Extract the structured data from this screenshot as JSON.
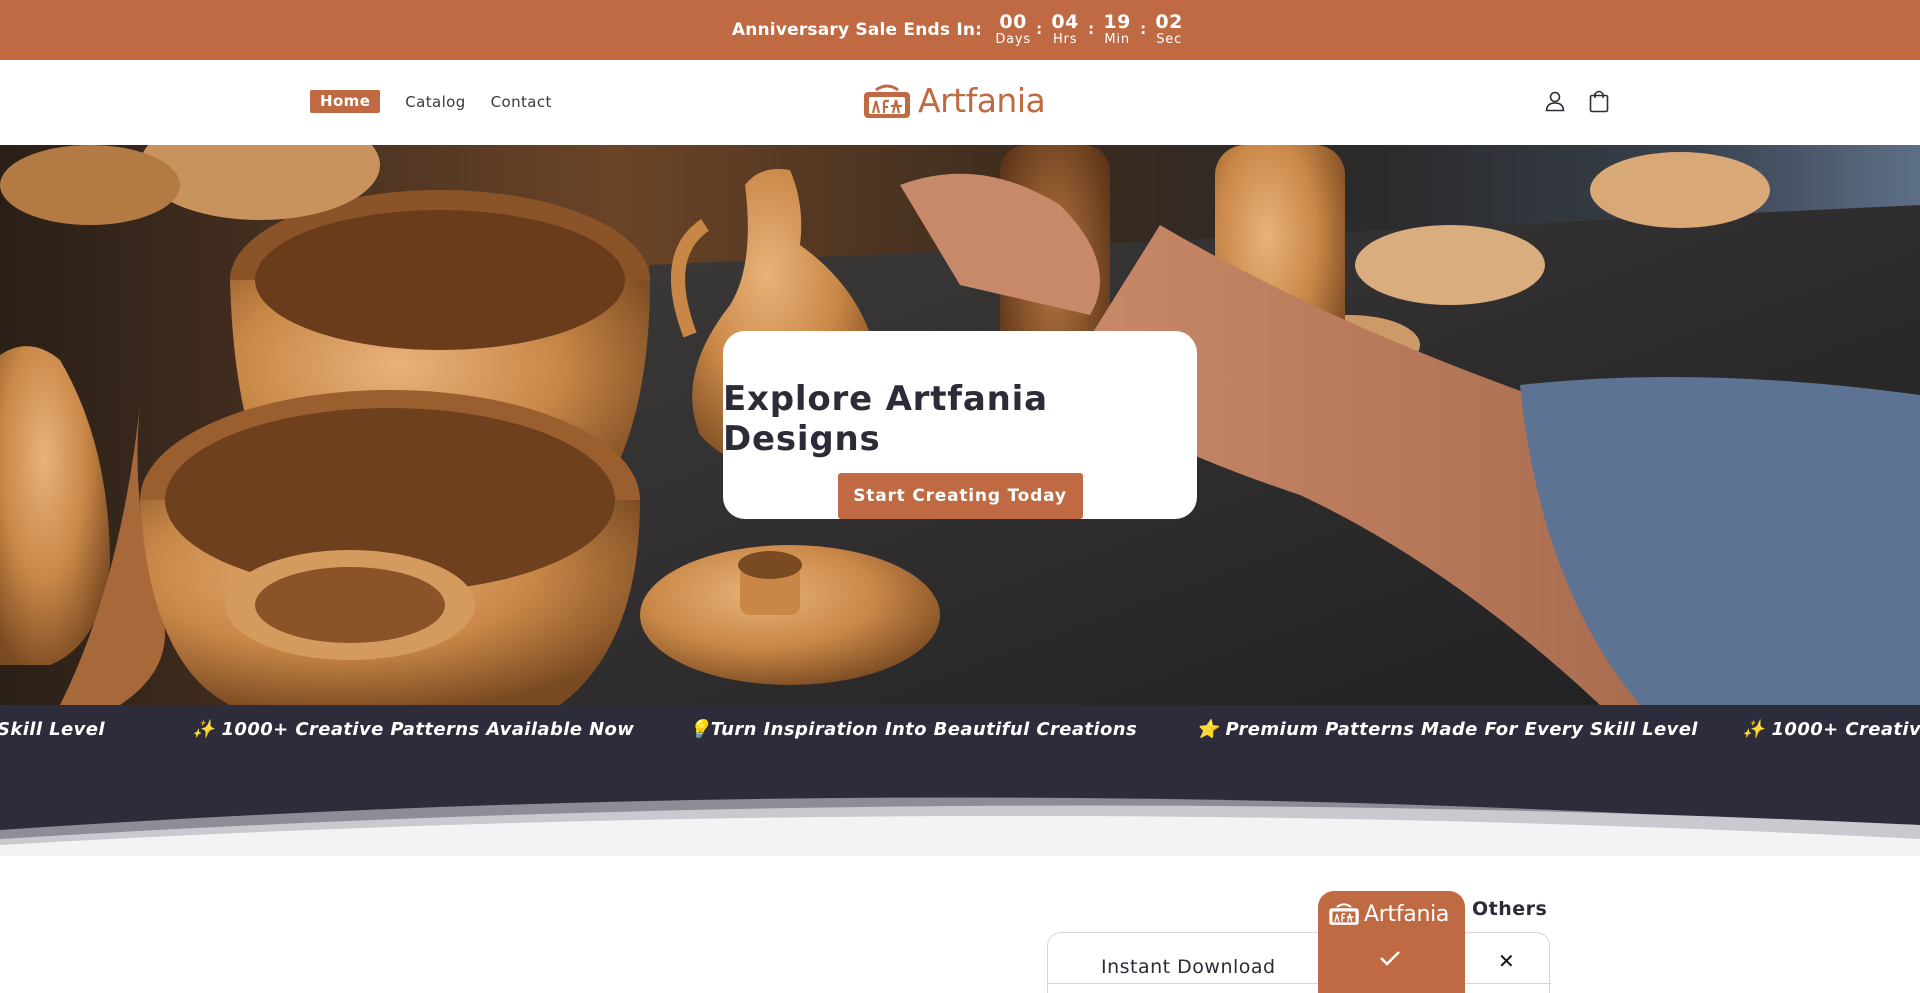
{
  "announcement": {
    "label": "Anniversary Sale Ends In:",
    "countdown": [
      {
        "value": "00",
        "unit": "Days"
      },
      {
        "value": "04",
        "unit": "Hrs"
      },
      {
        "value": "19",
        "unit": "Min"
      },
      {
        "value": "02",
        "unit": "Sec"
      }
    ],
    "separator": ":"
  },
  "nav": {
    "items": [
      {
        "label": "Home",
        "active": true
      },
      {
        "label": "Catalog",
        "active": false
      },
      {
        "label": "Contact",
        "active": false
      }
    ]
  },
  "brand": {
    "name": "Artfania",
    "accent_color": "#bf6a43",
    "dark_color": "#2c2c38"
  },
  "header_icons": [
    "account-icon",
    "cart-bag-icon"
  ],
  "hero": {
    "title": "Explore Artfania Designs",
    "cta_label": "Start Creating Today"
  },
  "marquee": {
    "items": [
      "Skill Level",
      "✨ 1000+ Creative Patterns Available Now",
      "💡Turn Inspiration Into Beautiful Creations",
      "⭐ Premium Patterns Made For Every Skill Level",
      "✨ 1000+ Creative P"
    ]
  },
  "comparison": {
    "others_label": "Others",
    "rows": [
      {
        "feature": "Instant Download",
        "artfania": "check-icon",
        "others": "✕"
      }
    ]
  }
}
